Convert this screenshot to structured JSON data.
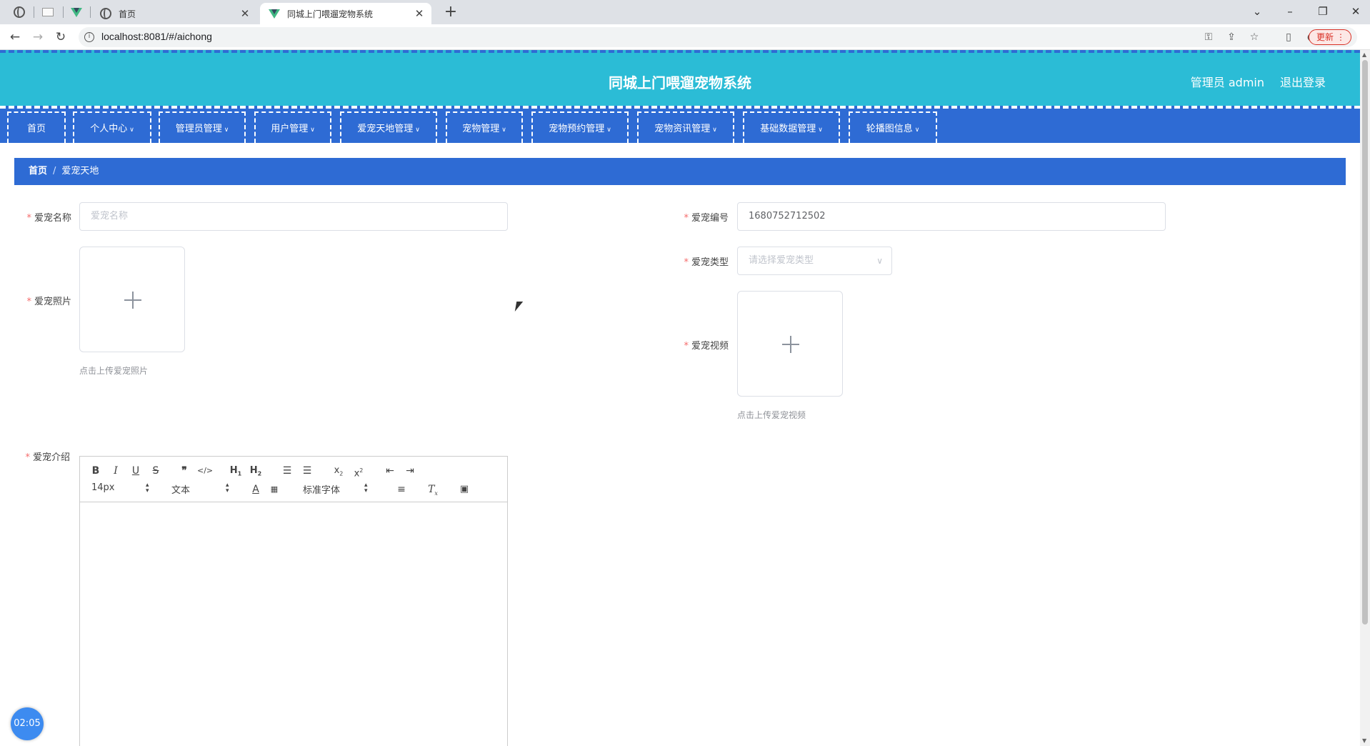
{
  "browser": {
    "tabs": [
      {
        "title": "首页",
        "active": false
      },
      {
        "title": "同城上门喂遛宠物系统",
        "active": true
      }
    ],
    "url": "localhost:8081/#/aichong",
    "update_label": "更新"
  },
  "header": {
    "title": "同城上门喂遛宠物系统",
    "admin_label": "管理员 admin",
    "logout_label": "退出登录"
  },
  "menu": {
    "items": [
      {
        "label": "首页",
        "has_caret": false
      },
      {
        "label": "个人中心",
        "has_caret": true
      },
      {
        "label": "管理员管理",
        "has_caret": true
      },
      {
        "label": "用户管理",
        "has_caret": true
      },
      {
        "label": "爱宠天地管理",
        "has_caret": true
      },
      {
        "label": "宠物管理",
        "has_caret": true
      },
      {
        "label": "宠物预约管理",
        "has_caret": true
      },
      {
        "label": "宠物资讯管理",
        "has_caret": true
      },
      {
        "label": "基础数据管理",
        "has_caret": true
      },
      {
        "label": "轮播图信息",
        "has_caret": true
      }
    ]
  },
  "breadcrumb": {
    "home": "首页",
    "separator": "/",
    "current": "爱宠天地"
  },
  "form": {
    "name": {
      "label": "爱宠名称",
      "placeholder": "爱宠名称",
      "value": ""
    },
    "number": {
      "label": "爱宠编号",
      "value": "1680752712502"
    },
    "type": {
      "label": "爱宠类型",
      "placeholder": "请选择爱宠类型"
    },
    "photo": {
      "label": "爱宠照片",
      "tip": "点击上传爱宠照片"
    },
    "video": {
      "label": "爱宠视频",
      "tip": "点击上传爱宠视频"
    },
    "intro": {
      "label": "爱宠介绍"
    }
  },
  "editor": {
    "font_size": "14px",
    "header_select": "文本",
    "font_family": "标准字体"
  },
  "clock": "02:05",
  "colors": {
    "header_bg": "#2bbcd6",
    "nav_bg": "#2e6bd4",
    "required": "#f56c6c"
  }
}
